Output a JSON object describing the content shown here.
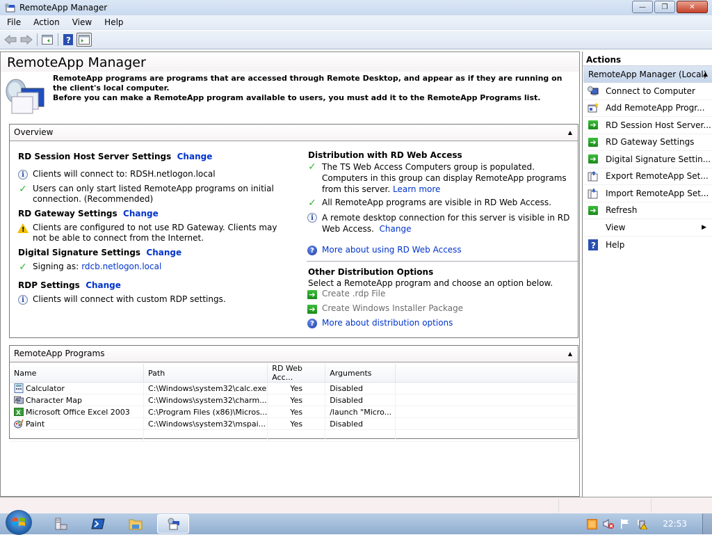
{
  "window": {
    "title": "RemoteApp Manager",
    "controls": {
      "minimize": "—",
      "restore": "❐",
      "close": "✕"
    }
  },
  "menu": [
    "File",
    "Action",
    "View",
    "Help"
  ],
  "toolbar": {
    "icons": [
      "back-arrow-icon",
      "forward-arrow-icon",
      "show-hide-console-tree-icon",
      "help-icon",
      "show-hide-action-pane-icon"
    ]
  },
  "page": {
    "title": "RemoteApp Manager",
    "intro_line1": "RemoteApp programs are programs that are accessed through Remote Desktop, and appear as if they are running on the client's local computer.",
    "intro_line2": "Before you can make a RemoteApp program available to users, you must add it to the RemoteApp Programs list."
  },
  "overview": {
    "header": "Overview",
    "left": {
      "rdsh": {
        "title": "RD Session Host Server Settings",
        "change": "Change",
        "items": [
          {
            "icon": "info",
            "text": "Clients will connect to: RDSH.netlogon.local"
          },
          {
            "icon": "check",
            "text": "Users can only start listed RemoteApp programs on initial connection. (Recommended)"
          }
        ]
      },
      "gateway": {
        "title": "RD Gateway Settings",
        "change": "Change",
        "items": [
          {
            "icon": "warning",
            "text": "Clients are configured to not use RD Gateway. Clients may not be able to connect from the Internet."
          }
        ]
      },
      "signature": {
        "title": "Digital Signature Settings",
        "change": "Change",
        "items": [
          {
            "icon": "check",
            "prefix": "Signing as: ",
            "link": "rdcb.netlogon.local"
          }
        ]
      },
      "rdp": {
        "title": "RDP Settings",
        "change": "Change",
        "items": [
          {
            "icon": "info",
            "text": "Clients will connect with custom RDP settings."
          }
        ]
      }
    },
    "right": {
      "webaccess": {
        "title": "Distribution with RD Web Access",
        "item1_text": "The TS Web Access Computers group is populated.  Computers in this group can display RemoteApp programs from this server.",
        "item1_link": "Learn more",
        "item2_text": "All RemoteApp programs are visible in RD Web Access.",
        "item3_text": "A remote desktop connection for this server is visible in RD Web Access.",
        "item3_link": "Change",
        "more_link": "More about using RD Web Access"
      },
      "other": {
        "title": "Other Distribution Options",
        "desc": "Select a RemoteApp program and choose an option below.",
        "create_rdp": "Create .rdp File",
        "create_msi": "Create Windows Installer Package",
        "more_link": "More about distribution options"
      }
    }
  },
  "programs": {
    "header": "RemoteApp Programs",
    "columns": [
      "Name",
      "Path",
      "RD Web Acc...",
      "Arguments"
    ],
    "rows": [
      {
        "icon": "calculator-icon",
        "name": "Calculator",
        "path": "C:\\Windows\\system32\\calc.exe",
        "rdweb": "Yes",
        "args": "Disabled"
      },
      {
        "icon": "character-map-icon",
        "name": "Character Map",
        "path": "C:\\Windows\\system32\\charm...",
        "rdweb": "Yes",
        "args": "Disabled"
      },
      {
        "icon": "excel-icon",
        "name": "Microsoft Office Excel 2003",
        "path": "C:\\Program Files (x86)\\Micros...",
        "rdweb": "Yes",
        "args": "/launch \"Micro..."
      },
      {
        "icon": "paint-icon",
        "name": "Paint",
        "path": "C:\\Windows\\system32\\mspai...",
        "rdweb": "Yes",
        "args": "Disabled"
      }
    ]
  },
  "actions": {
    "header": "Actions",
    "group": "RemoteApp Manager (Local)",
    "items": [
      {
        "label": "Connect to Computer",
        "icon": "connect-computer-icon"
      },
      {
        "label": "Add RemoteApp Progr...",
        "icon": "add-program-icon"
      },
      {
        "label": "RD Session Host Server...",
        "icon": "green-arrow-icon"
      },
      {
        "label": "RD Gateway Settings",
        "icon": "green-arrow-icon"
      },
      {
        "label": "Digital Signature Settin...",
        "icon": "green-arrow-icon"
      },
      {
        "label": "Export RemoteApp Set...",
        "icon": "export-icon"
      },
      {
        "label": "Import RemoteApp Set...",
        "icon": "import-icon"
      },
      {
        "label": "Refresh",
        "icon": "green-arrow-icon"
      },
      {
        "label": "View",
        "icon": "",
        "submenu": true
      },
      {
        "label": "Help",
        "icon": "help-icon"
      }
    ]
  },
  "taskbar": {
    "items": [
      "server-manager-icon",
      "powershell-icon",
      "explorer-icon",
      "remoteapp-manager-icon"
    ],
    "tray": [
      "action-center-flag-icon",
      "volume-muted-icon",
      "flag-icon",
      "network-warning-icon"
    ],
    "clock": "22:53"
  },
  "colors": {
    "link": "#0033cc",
    "check": "#34b234",
    "warning": "#f2c100",
    "actions_group_bg": "#c6d5ea"
  }
}
